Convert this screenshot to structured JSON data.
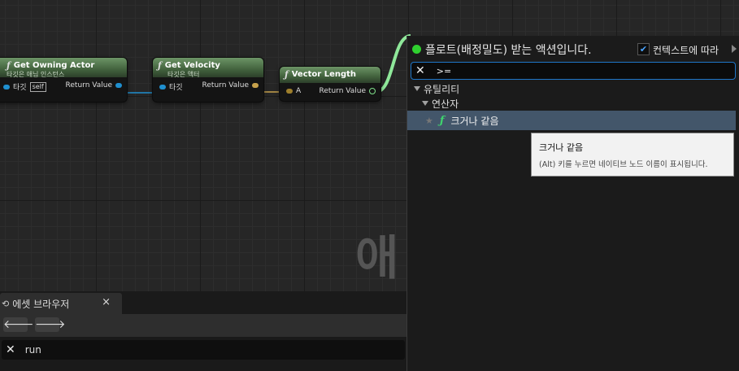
{
  "graph": {
    "watermark": "애",
    "nodes": {
      "get_owning_actor": {
        "title": "Get Owning Actor",
        "subtitle": "타깃은 애님 인스턴스",
        "input_label": "타깃",
        "self_label": "self",
        "output_label": "Return Value"
      },
      "get_velocity": {
        "title": "Get Velocity",
        "subtitle": "타깃은 액터",
        "input_label": "타깃",
        "output_label": "Return Value"
      },
      "vector_length": {
        "title": "Vector Length",
        "input_label": "A",
        "output_label": "Return Value"
      }
    },
    "function_glyph": "ƒ"
  },
  "asset_browser": {
    "tab_label": "에셋 브라우저",
    "close_glyph": "×",
    "back_glyph": "🡐",
    "forward_glyph": "🡒",
    "search_clear_glyph": "✕",
    "search_value": "run"
  },
  "action_menu": {
    "title": "플로트(배정밀도) 받는 액션입니다.",
    "context_check_glyph": "✔",
    "context_label": "컨텍스트에 따라",
    "search_clear_glyph": "✕",
    "search_value": ">=",
    "categories": [
      {
        "label": "유틸리티"
      },
      {
        "label": "연산자"
      }
    ],
    "selected_item": {
      "star": "★",
      "glyph": "ƒ",
      "label": "크거나 같음"
    }
  },
  "tooltip": {
    "title": "크거나 같음",
    "description": "(Alt) 키를 누르면 네이티브 노드 이름이 표시됩니다."
  },
  "colors": {
    "status_green": "#2fd02f",
    "selection": "#43566a",
    "search_border": "#1f76c8",
    "exec_wire": "#7fe08a",
    "object_pin": "#1f8fcf",
    "vector_pin": "#c7a24c"
  }
}
